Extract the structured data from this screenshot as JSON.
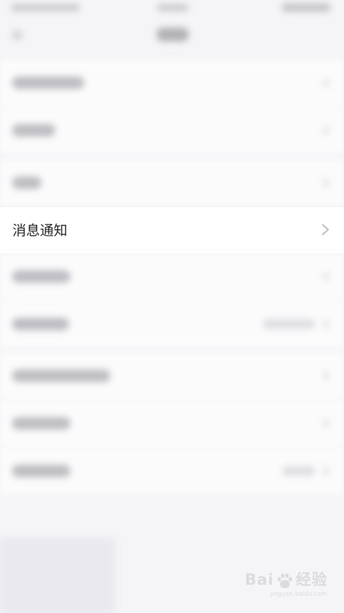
{
  "highlighted_row": {
    "label": "消息通知",
    "chevron_icon": "chevron-right-icon"
  },
  "watermark": {
    "text_left": "Bai",
    "text_right": "经验",
    "sub": "jingyan.baidu.com"
  },
  "colors": {
    "background": "#f5f5f7",
    "row_bg": "#ffffff",
    "text": "#1f1f22",
    "chevron": "#b8b8bd"
  }
}
